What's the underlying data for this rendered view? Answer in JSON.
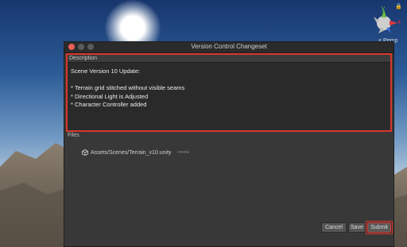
{
  "window": {
    "title": "Version Control Changeset"
  },
  "description": {
    "header": "Description",
    "text": "Scene Version 10 Update:\n\n* Terrain grid stitched without visible seams\n* Directional Light is Adjusted\n* Character Controller added"
  },
  "files": {
    "header": "Files",
    "items": [
      {
        "name": "Assets/Scenes/Terrain_v10.unity",
        "meta": "+meta"
      }
    ]
  },
  "buttons": {
    "cancel": "Cancel",
    "save": "Save",
    "submit": "Submit"
  },
  "gizmo": {
    "x_label": "x",
    "y_label": "y",
    "persp_label": "< Persp"
  },
  "colors": {
    "highlight": "#d9362c"
  }
}
